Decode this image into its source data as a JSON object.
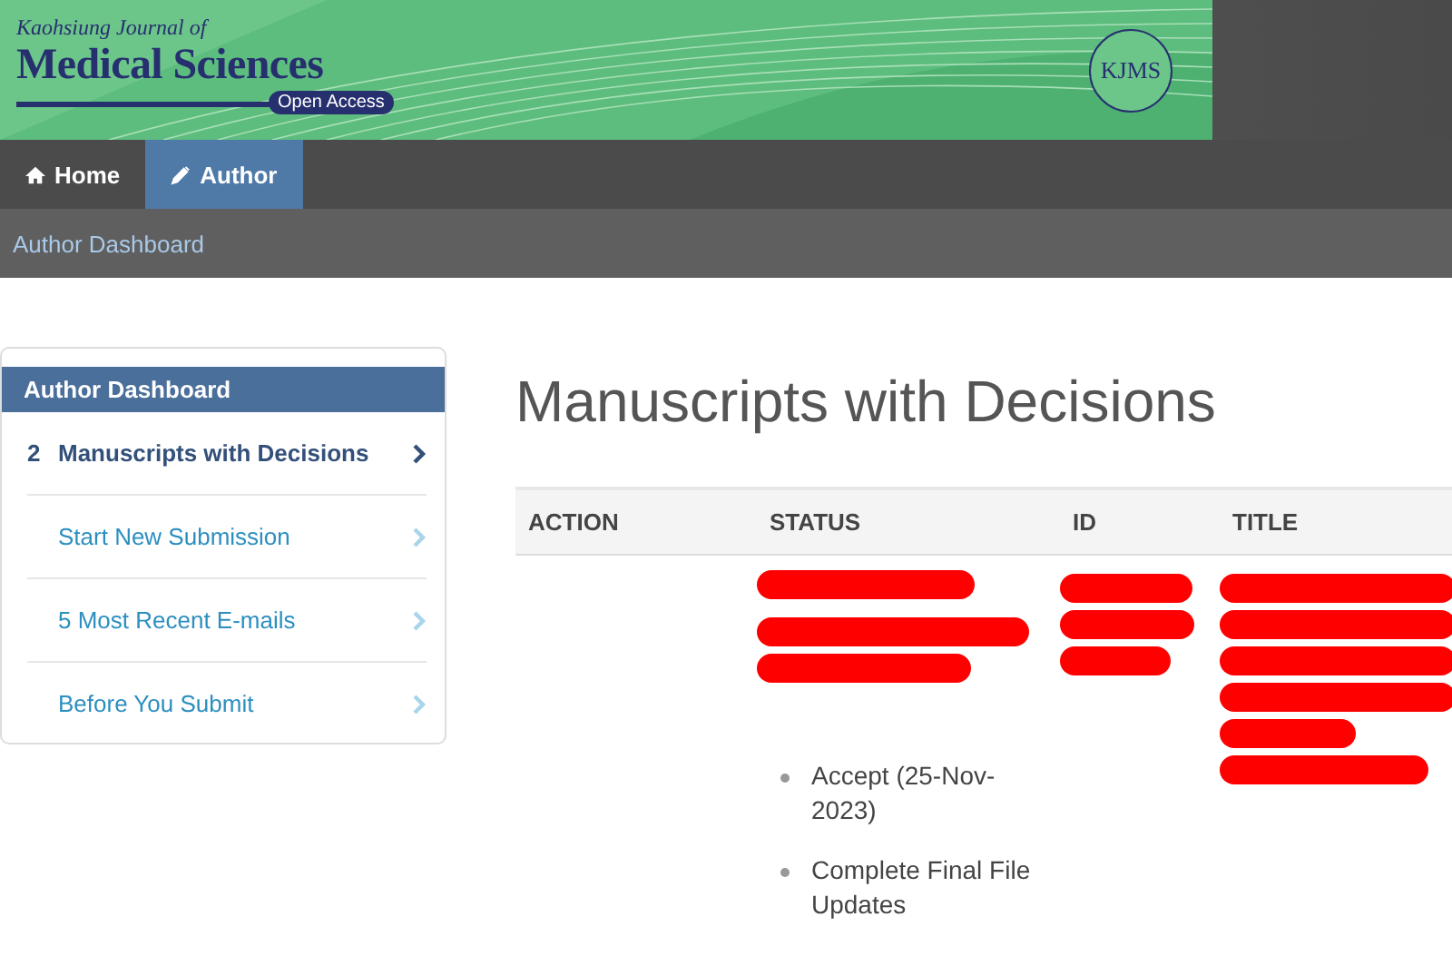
{
  "banner": {
    "journal_prefix": "Kaohsiung Journal of",
    "journal_name": "Medical Sciences",
    "access": "Open Access",
    "seal": "KJMS"
  },
  "nav": [
    {
      "label": "Home",
      "kind": "home",
      "selected": false
    },
    {
      "label": "Author",
      "kind": "edit",
      "selected": true
    }
  ],
  "breadcrumb": "Author Dashboard",
  "sidebar": {
    "title": "Author Dashboard",
    "items": [
      {
        "count": "2",
        "label": "Manuscripts with Decisions",
        "selected": true
      },
      {
        "label": "Start New Submission",
        "selected": false
      },
      {
        "label": "5 Most Recent E-mails",
        "selected": false
      },
      {
        "label": "Before You Submit",
        "selected": false
      }
    ]
  },
  "page_title": "Manuscripts with Decisions",
  "table": {
    "columns": [
      "ACTION",
      "STATUS",
      "ID",
      "TITLE"
    ],
    "rows": [
      {
        "status_items": [
          "Accept (25-Nov-2023)",
          "Complete Final File Updates"
        ]
      }
    ]
  }
}
